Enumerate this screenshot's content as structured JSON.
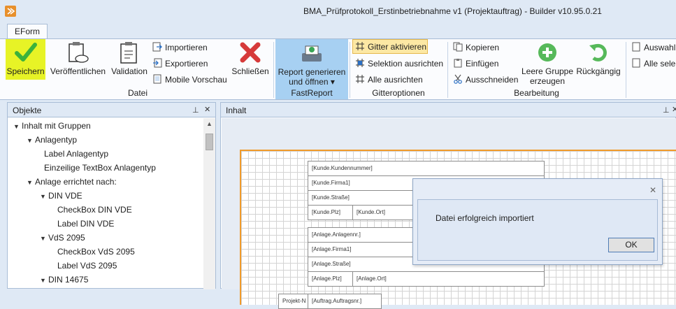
{
  "window": {
    "title": "BMA_Prüfprotokoll_Erstinbetriebnahme v1 (Projektauftrag) - Builder v10.95.0.21"
  },
  "ribbon": {
    "tab": "EForm",
    "groups": {
      "datei": {
        "label": "Datei",
        "save": "Speichern",
        "publish": "Veröffentlichen",
        "validation": "Validation",
        "import": "Importieren",
        "export": "Exportieren",
        "mobile": "Mobile Vorschau",
        "close": "Schließen"
      },
      "fastreport": {
        "label": "FastReport",
        "report_line1": "Report generieren",
        "report_line2": "und öffnen ▾"
      },
      "grid": {
        "label": "Gitteroptionen",
        "activate": "Gitter aktivieren",
        "align_selection": "Selektion ausrichten",
        "align_all": "Alle ausrichten"
      },
      "edit": {
        "label": "Bearbeitung",
        "copy": "Kopieren",
        "paste": "Einfügen",
        "cut": "Ausschneiden",
        "empty_group_line1": "Leere Gruppe",
        "empty_group_line2": "erzeugen",
        "undo": "Rückgängig"
      },
      "selection": {
        "choice": "Auswahl",
        "all": "Alle selek"
      }
    }
  },
  "objects_panel": {
    "title": "Objekte",
    "tree": [
      {
        "label": "Inhalt mit Gruppen",
        "level": 0,
        "expanded": true
      },
      {
        "label": "Anlagentyp",
        "level": 1,
        "expanded": true
      },
      {
        "label": "Label Anlagentyp",
        "level": 2
      },
      {
        "label": "Einzeilige TextBox Anlagentyp",
        "level": 2
      },
      {
        "label": "Anlage errichtet nach:",
        "level": 1,
        "expanded": true
      },
      {
        "label": "DIN VDE",
        "level": 2,
        "expanded": true
      },
      {
        "label": "CheckBox DIN VDE",
        "level": 3
      },
      {
        "label": "Label DIN VDE",
        "level": 3
      },
      {
        "label": "VdS 2095",
        "level": 2,
        "expanded": true
      },
      {
        "label": "CheckBox VdS 2095",
        "level": 3
      },
      {
        "label": "Label VdS 2095",
        "level": 3
      },
      {
        "label": "DIN 14675",
        "level": 2,
        "expanded": true
      }
    ]
  },
  "content_panel": {
    "title": "Inhalt",
    "fields": [
      "[Kunde.Kundennummer]",
      "[Kunde.Firma1]",
      "[Kunde.Straße]",
      "[Kunde.Plz]",
      "[Kunde.Ort]",
      "[Anlage.Anlagennr.]",
      "[Anlage.Firma1]",
      "[Anlage.Straße]",
      "[Anlage.Plz]",
      "[Anlage.Ort]",
      "Projekt-N",
      "[Auftrag.Auftragsnr.]"
    ]
  },
  "dialog": {
    "message": "Datei erfolgreich importiert",
    "ok": "OK"
  },
  "colors": {
    "accent_highlight": "#e7f326",
    "active_group": "#a7d0f2",
    "design_border": "#f09a2a",
    "chrome_bg": "#dfe9f5"
  }
}
